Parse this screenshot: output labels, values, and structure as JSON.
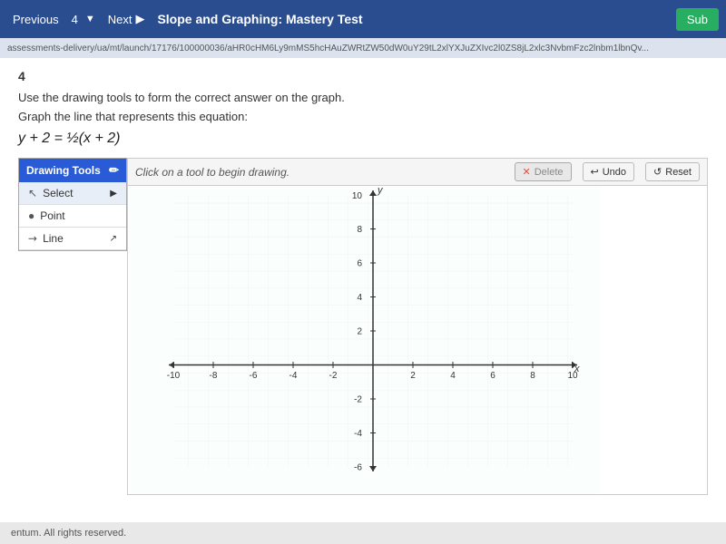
{
  "nav": {
    "previous_label": "Previous",
    "next_label": "Next",
    "page_number": "4",
    "page_title": "Slope and Graphing: Mastery Test",
    "submit_label": "Sub"
  },
  "url": "assessments-delivery/ua/mt/launch/17176/100000036/aHR0cHM6Ly9mMS5hcHAuZWRtZW50dW0uY29tL2xlYXJuZXIvc2l0ZS8jL2xlc3NvbmFzc2lnbm1lbnQv...",
  "question": {
    "number": "4",
    "instruction": "Use the drawing tools to form the correct answer on the graph.",
    "prompt": "Graph the line that represents this equation:",
    "equation": "y + 2 = ½(x + 2)"
  },
  "drawing_tools": {
    "header": "Drawing Tools",
    "tools": [
      {
        "name": "Select",
        "icon": "↖"
      },
      {
        "name": "Point",
        "icon": "●"
      },
      {
        "name": "Line",
        "icon": "↗"
      }
    ]
  },
  "graph_toolbar": {
    "hint": "Click on a tool to begin drawing.",
    "delete_label": "Delete",
    "undo_label": "Undo",
    "reset_label": "Reset"
  },
  "graph": {
    "x_min": -10,
    "x_max": 10,
    "y_min": -6,
    "y_max": 10,
    "x_label": "x",
    "y_label": "y"
  },
  "footer": {
    "text": "entum. All rights reserved."
  }
}
